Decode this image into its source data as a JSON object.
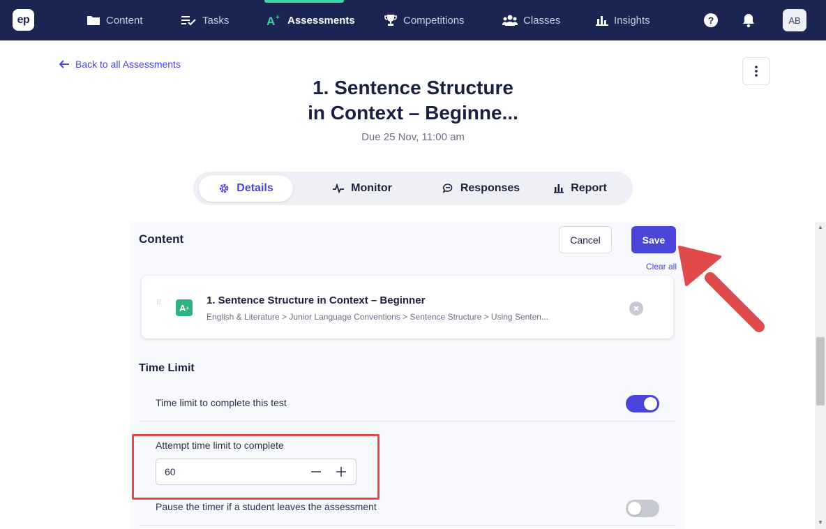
{
  "nav": {
    "logo": "ep",
    "items": [
      {
        "label": "Content",
        "icon": "folder-icon"
      },
      {
        "label": "Tasks",
        "icon": "checklist-icon"
      },
      {
        "label": "Assessments",
        "icon": "assessment-icon"
      },
      {
        "label": "Competitions",
        "icon": "trophy-icon"
      },
      {
        "label": "Classes",
        "icon": "users-icon"
      },
      {
        "label": "Insights",
        "icon": "bar-chart-icon"
      }
    ],
    "active": "Assessments",
    "avatar": "AB"
  },
  "header": {
    "back_link": "Back to all Assessments",
    "title_line1": "1. Sentence Structure",
    "title_line2": "in Context – Beginne...",
    "due": "Due 25 Nov, 11:00 am"
  },
  "tabs": [
    {
      "label": "Details",
      "icon": "gear-icon",
      "active": true
    },
    {
      "label": "Monitor",
      "icon": "pulse-icon",
      "active": false
    },
    {
      "label": "Responses",
      "icon": "chat-icon",
      "active": false
    },
    {
      "label": "Report",
      "icon": "bar-chart-icon",
      "active": false
    }
  ],
  "content": {
    "heading": "Content",
    "cancel_label": "Cancel",
    "save_label": "Save",
    "clear_all_label": "Clear all",
    "item": {
      "title": "1. Sentence Structure in Context – Beginner",
      "path": "English & Literature > Junior Language Conventions > Sentence Structure > Using Senten..."
    }
  },
  "time_limit": {
    "heading": "Time Limit",
    "toggle_label": "Time limit to complete this test",
    "toggle_on": true,
    "attempt_label": "Attempt time limit to complete",
    "attempt_value": "60",
    "pause_label": "Pause the timer if a student leaves the assessment",
    "pause_on": false
  },
  "colors": {
    "topbar": "#1c2552",
    "accent": "#4a45d8",
    "active_indicator": "#3ad6a3",
    "annotation_red": "#e04a4a"
  }
}
